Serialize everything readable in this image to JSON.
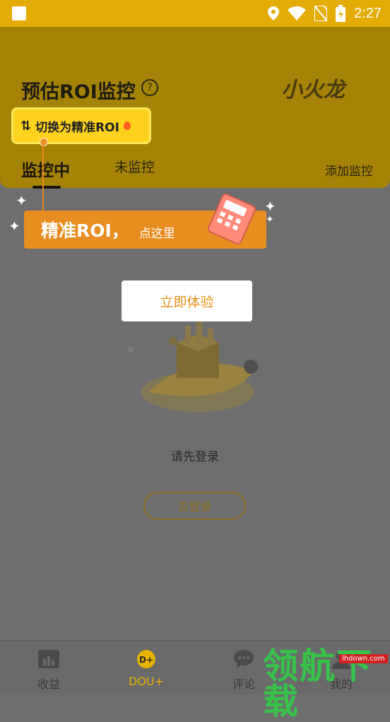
{
  "status_bar": {
    "time": "2:27"
  },
  "header": {
    "title": "预估ROI监控",
    "logo_text": "小火龙",
    "switch_button_label": "切换为精准ROI",
    "tabs": [
      {
        "label": "监控中"
      },
      {
        "label": "未监控"
      }
    ],
    "add_monitor_label": "添加监控"
  },
  "tooltip": {
    "main": "精准ROI，",
    "sub": "点这里"
  },
  "overlay": {
    "try_button_label": "立即体验"
  },
  "empty_state": {
    "prompt": "请先登录",
    "login_button_label": "去登录"
  },
  "bottom_nav": {
    "items": [
      {
        "label": "收益",
        "icon": "chart-icon"
      },
      {
        "label": "DOU+",
        "icon": "dou-plus-icon"
      },
      {
        "label": "评论",
        "icon": "comment-icon"
      },
      {
        "label": "我的",
        "icon": "profile-icon"
      }
    ]
  },
  "watermark": {
    "text": "领航下载",
    "url": "lhdown.com"
  },
  "colors": {
    "accent": "#ffd21e",
    "orange": "#e88d1f",
    "overlay": "#6e6e6e"
  }
}
